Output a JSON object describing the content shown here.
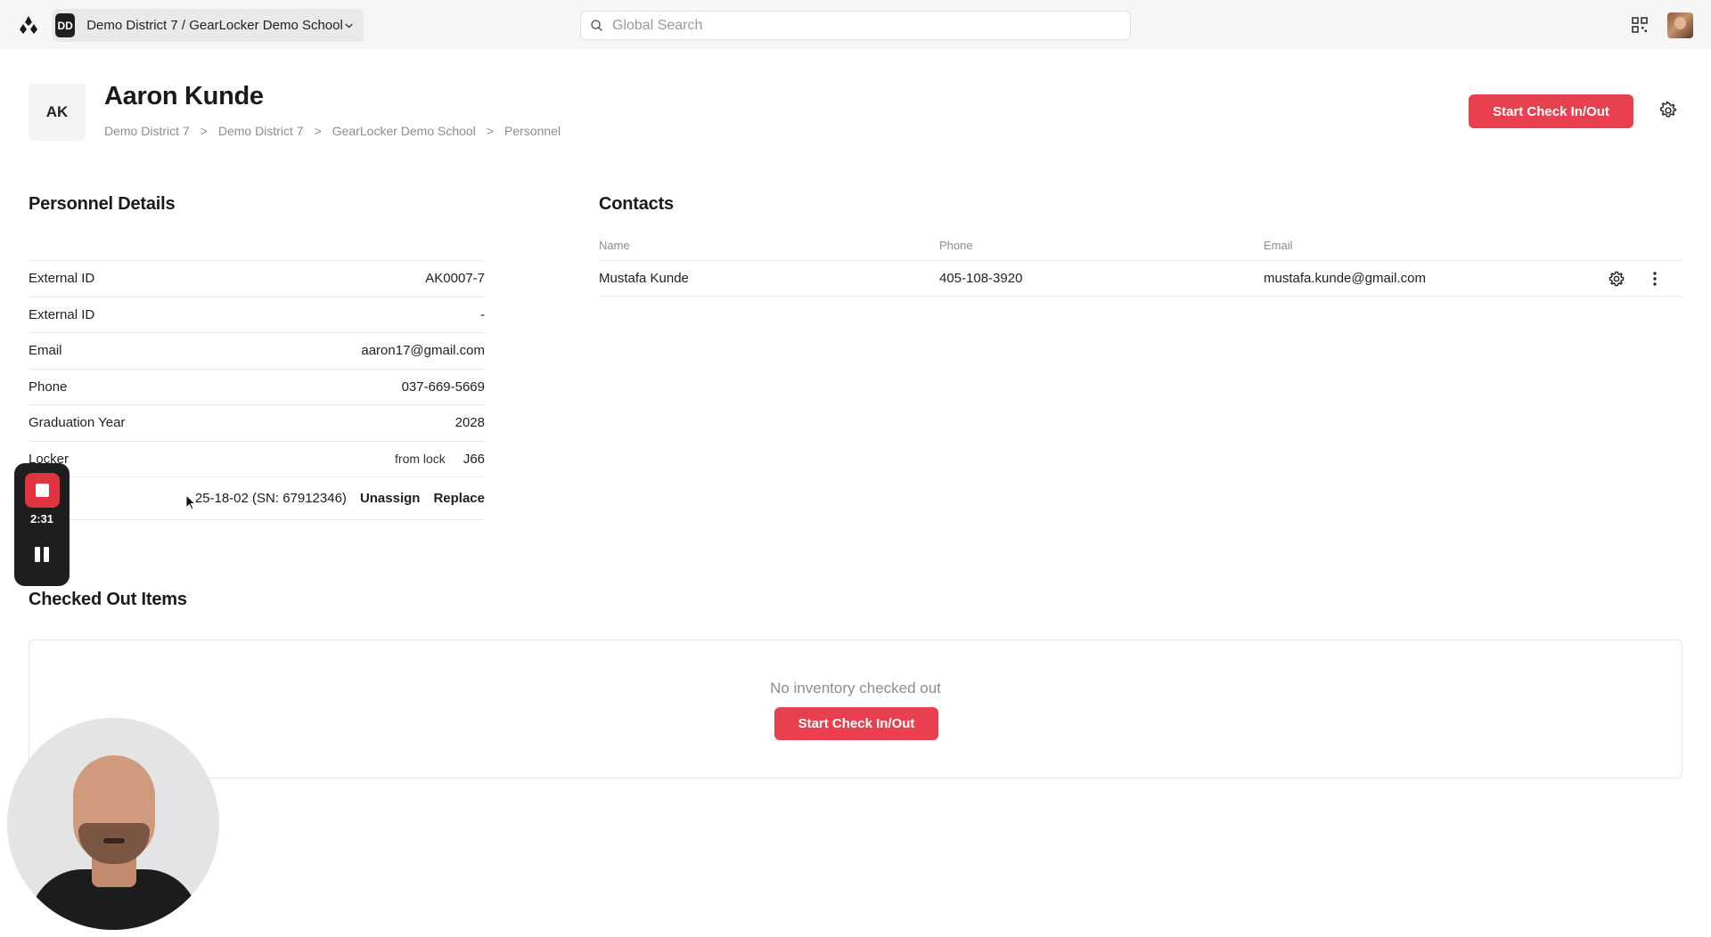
{
  "topbar": {
    "org_initials": "DD",
    "org_name": "Demo District 7 / GearLocker Demo School",
    "search_placeholder": "Global Search"
  },
  "header": {
    "initials": "AK",
    "name": "Aaron Kunde",
    "breadcrumb": [
      "Demo District 7",
      "Demo District 7",
      "GearLocker Demo School",
      "Personnel"
    ],
    "breadcrumb_sep": ">",
    "action_label": "Start Check In/Out"
  },
  "personnel_details": {
    "title": "Personnel Details",
    "rows": [
      {
        "label": "External ID",
        "value": "AK0007-7"
      },
      {
        "label": "External ID",
        "value": "-"
      },
      {
        "label": "Email",
        "value": "aaron17@gmail.com"
      },
      {
        "label": "Phone",
        "value": "037-669-5669"
      },
      {
        "label": "Graduation Year",
        "value": "2028"
      }
    ],
    "locker": {
      "label": "Locker",
      "from_text": "from lock",
      "value": "J66",
      "lock_text": "25-18-02 (SN: 67912346)",
      "unassign": "Unassign",
      "replace": "Replace"
    }
  },
  "contacts": {
    "title": "Contacts",
    "columns": [
      "Name",
      "Phone",
      "Email"
    ],
    "rows": [
      {
        "name": "Mustafa Kunde",
        "phone": "405-108-3920",
        "email": "mustafa.kunde@gmail.com"
      }
    ]
  },
  "checked_out": {
    "title": "Checked Out Items",
    "empty_text": "No inventory checked out",
    "action_label": "Start Check In/Out"
  },
  "recorder": {
    "time": "2:31"
  },
  "colors": {
    "accent": "#e8404e",
    "topbar_bg": "#f6f6f6"
  }
}
